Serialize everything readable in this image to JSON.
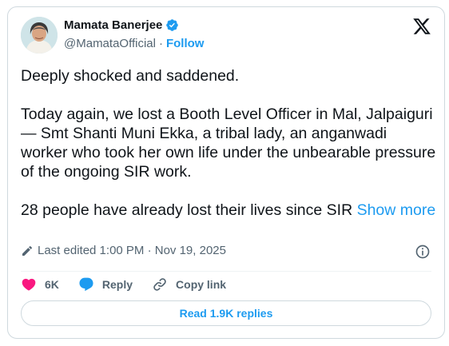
{
  "author": {
    "name": "Mamata Banerjee",
    "handle": "@MamataOfficial",
    "separator": "·",
    "follow_label": "Follow",
    "verified": true
  },
  "brand_logo": "x-logo-icon",
  "post": {
    "paragraph1": "Deeply shocked and saddened.",
    "paragraph2": "Today again, we lost a Booth Level Officer in Mal, Jalpaiguri — Smt Shanti Muni Ekka, a tribal lady, an anganwadi worker who took her own life under the unbearable pressure of the ongoing SIR work.",
    "paragraph3": "28 people have already lost their lives since SIR",
    "show_more_label": "Show more"
  },
  "meta": {
    "edited_text": "Last edited 1:00 PM · Nov 19, 2025"
  },
  "actions": {
    "likes": "6K",
    "reply_label": "Reply",
    "copy_link_label": "Copy link"
  },
  "replies_button_label": "Read 1.9K replies",
  "colors": {
    "accent": "#1d9bf0",
    "like": "#f91880",
    "text": "#0f1419",
    "secondary": "#536471",
    "border": "#cfd9de"
  }
}
